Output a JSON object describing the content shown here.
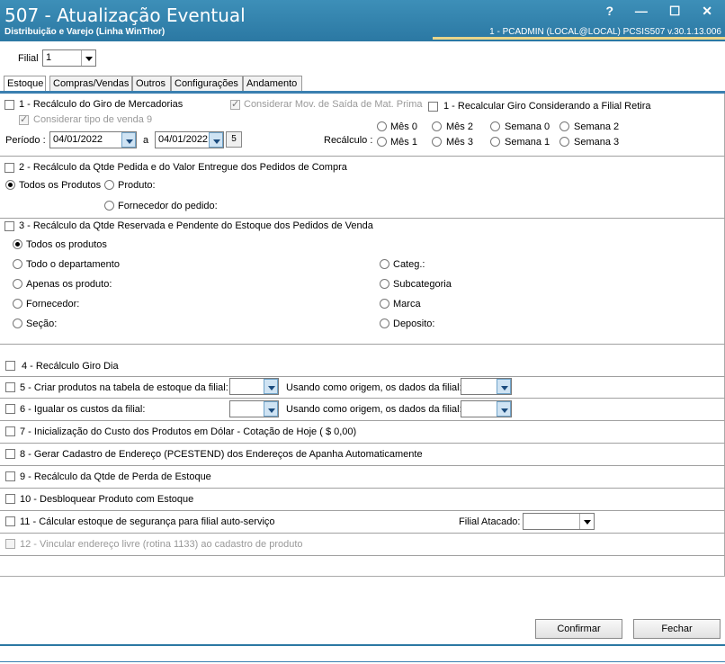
{
  "window": {
    "title": "507 - Atualização Eventual",
    "subtitle": "Distribuição e Varejo (Linha WinThor)",
    "info": "1 - PCADMIN (LOCAL@LOCAL)   PCSIS507  v.30.1.13.006",
    "help": "?",
    "minimize": "—",
    "maximize": "☐",
    "close": "✕"
  },
  "filial": {
    "label": "Filial",
    "value": "1"
  },
  "tabs": [
    "Estoque",
    "Compras/Vendas",
    "Outros",
    "Configurações",
    "Andamento"
  ],
  "s1": {
    "label": "1 - Recálculo do Giro de Mercadorias",
    "mov_saida": "Considerar Mov. de Saída de Mat. Prima",
    "filial_retira": "1 - Recalcular Giro Considerando a Filial Retira",
    "tipo_venda": "Considerar tipo de venda 9",
    "periodo_label": "Período :",
    "date_from": "04/01/2022",
    "a": "a",
    "date_to": "04/01/2022",
    "recalculo_label": "Recálculo :",
    "options": [
      "Mês 0",
      "Mês 2",
      "Semana 0",
      "Semana 2",
      "Mês 1",
      "Mês 3",
      "Semana 1",
      "Semana 3"
    ]
  },
  "s2": {
    "label": "2 - Recálculo da Qtde Pedida e do Valor Entregue dos Pedidos de Compra",
    "todos": "Todos os Produtos",
    "produto": "Produto:",
    "fornecedor": "Fornecedor do pedido:"
  },
  "s3": {
    "label": "3 - Recálculo da Qtde Reservada e Pendente do Estoque dos Pedidos de Venda",
    "todos": "Todos os produtos",
    "departamento": "Todo o departamento",
    "apenas": "Apenas os produto:",
    "fornecedor": "Fornecedor:",
    "secao": "Seção:",
    "categ": "Categ.:",
    "subcategoria": "Subcategoria",
    "marca": "Marca",
    "deposito": "Deposito:"
  },
  "s4": {
    "label": "4 - Recálculo Giro Dia"
  },
  "s5": {
    "label": "5 - Criar produtos na tabela de estoque da filial:",
    "origem": "Usando como origem, os dados da filial:"
  },
  "s6": {
    "label": "6 - Igualar os custos da filial:",
    "origem": "Usando como origem, os dados da filial:"
  },
  "s7": {
    "label": "7 - Inicialização do Custo dos Produtos em Dólar - Cotação de Hoje ( $ 0,00)"
  },
  "s8": {
    "label": "8 - Gerar Cadastro de Endereço (PCESTEND) dos Endereços de Apanha Automaticamente"
  },
  "s9": {
    "label": "9 - Recálculo da Qtde de Perda de Estoque"
  },
  "s10": {
    "label": "10 - Desbloquear Produto com Estoque"
  },
  "s11": {
    "label": "11 - Cálcular estoque de segurança para filial auto-serviço",
    "atacado": "Filial Atacado:"
  },
  "s12": {
    "label": "12 - Vincular endereço livre (rotina 1133) ao cadastro de produto"
  },
  "buttons": {
    "confirmar": "Confirmar",
    "fechar": "Fechar"
  },
  "colors": {
    "titlebar": "#2b78a3",
    "accent": "#3a7fb0"
  }
}
